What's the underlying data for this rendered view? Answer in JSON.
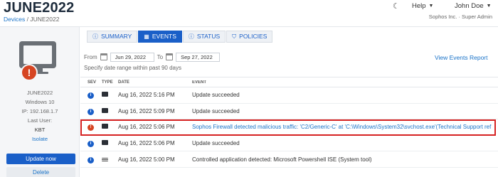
{
  "header": {
    "title": "JUNE2022",
    "breadcrumb": {
      "root": "Devices",
      "separator": "/",
      "current": "JUNE2022"
    },
    "help_label": "Help",
    "user_label": "John Doe",
    "org_label": "Sophos Inc. · Super Admin"
  },
  "device": {
    "name": "JUNE2022",
    "os": "Windows 10",
    "ip": "IP: 192.168.1.7",
    "last_user_label": "Last User:",
    "last_user": "KBT",
    "isolate_label": "Isolate",
    "update_button": "Update now",
    "delete_button": "Delete"
  },
  "tabs": [
    {
      "label": "SUMMARY",
      "icon": "info-icon"
    },
    {
      "label": "EVENTS",
      "icon": "grid-icon"
    },
    {
      "label": "STATUS",
      "icon": "info-icon"
    },
    {
      "label": "POLICIES",
      "icon": "shield-icon"
    }
  ],
  "active_tab": "EVENTS",
  "filter": {
    "from_label": "From",
    "from_date": "Jun 29, 2022",
    "to_label": "To",
    "to_date": "Sep 27, 2022",
    "range_note": "Specify date range within past 90 days",
    "view_report": "View Events Report"
  },
  "table": {
    "columns": [
      "SEV",
      "TYPE",
      "DATE",
      "EVENT"
    ],
    "rows": [
      {
        "sev": "info",
        "type": "device-icon",
        "date": "Aug 16, 2022 5:16 PM",
        "event": "Update succeeded"
      },
      {
        "sev": "info",
        "type": "device-icon",
        "date": "Aug 16, 2022 5:09 PM",
        "event": "Update succeeded"
      },
      {
        "sev": "error",
        "type": "device-icon",
        "date": "Aug 16, 2022 5:06 PM",
        "event": "Sophos Firewall detected malicious traffic: 'C2/Generic-C' at 'C:\\Windows\\System32\\svchost.exe'(Technical Support ref"
      },
      {
        "sev": "info",
        "type": "device-icon",
        "date": "Aug 16, 2022 5:06 PM",
        "event": "Update succeeded"
      },
      {
        "sev": "info",
        "type": "app-control-icon",
        "date": "Aug 16, 2022 5:00 PM",
        "event": "Controlled application detected: Microsoft Powershell ISE (System tool)"
      }
    ]
  },
  "colors": {
    "accent": "#1a5fc8",
    "error": "#d64422",
    "highlight": "#d62222"
  }
}
